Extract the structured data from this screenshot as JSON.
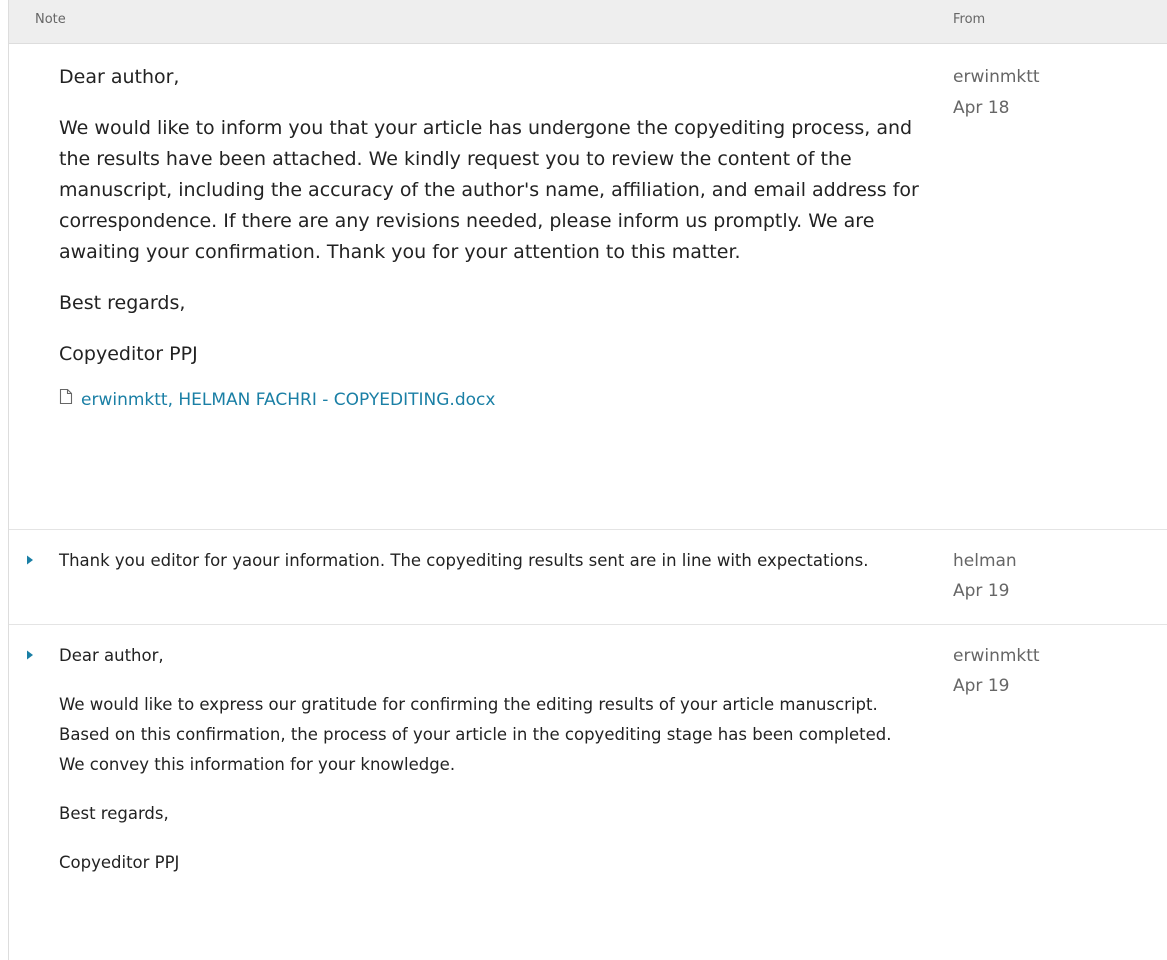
{
  "header": {
    "note_label": "Note",
    "from_label": "From"
  },
  "notes": [
    {
      "paragraphs": [
        "Dear author,",
        "We would like to inform you that your article has undergone the copyediting process, and the results have been attached. We kindly request you to review the content of the manuscript, including the accuracy of the author's name, affiliation, and email address for correspondence. If there are any revisions needed, please inform us promptly. We are awaiting your confirmation. Thank you for your attention to this matter.",
        "Best regards,",
        "Copyeditor PPJ"
      ],
      "attachment": {
        "icon": "file-icon",
        "label": "erwinmktt, HELMAN FACHRI - COPYEDITING.docx"
      },
      "author": "erwinmktt",
      "date": "Apr 18"
    },
    {
      "paragraphs": [
        "Thank you editor for yaour information. The copyediting results sent are in line with expectations."
      ],
      "toggle_icon": "caret-right-icon",
      "author": "helman",
      "date": "Apr 19"
    },
    {
      "paragraphs": [
        "Dear author,",
        "We would like to express our gratitude for confirming the editing results of your article manuscript. Based on this confirmation, the process of your article in the copyediting stage has been completed. We convey this information for your knowledge.",
        "Best regards,",
        "Copyeditor PPJ"
      ],
      "toggle_icon": "caret-right-icon",
      "author": "erwinmktt",
      "date": "Apr 19"
    }
  ],
  "colors": {
    "header_bg": "#eeeeee",
    "link": "#1a7fa5",
    "toggle": "#1a7fa5",
    "muted_text": "#666666"
  }
}
